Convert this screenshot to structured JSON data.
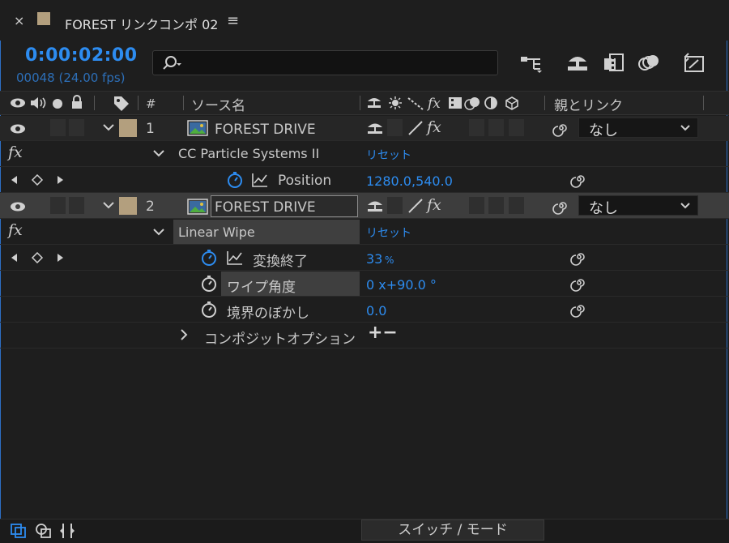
{
  "tab": {
    "close": "×",
    "title": "FOREST リンクコンポ 02",
    "menu": "≡",
    "swatch_color": "#b39f7e"
  },
  "time": {
    "timecode": "0:00:02:00",
    "frames": "00048 (24.00 fps)"
  },
  "search": {
    "value": "",
    "placeholder": ""
  },
  "columns": {
    "hash": "#",
    "source_name": "ソース名",
    "parent_link": "親とリンク"
  },
  "layers": [
    {
      "number": "1",
      "name": "FOREST DRIVE",
      "parent": "なし",
      "selected": false
    },
    {
      "number": "2",
      "name": "FOREST DRIVE",
      "parent": "なし",
      "selected": true
    }
  ],
  "effects": {
    "particle": {
      "fx": "fx",
      "name": "CC Particle Systems II",
      "reset": "リセット",
      "property": {
        "name": "Position",
        "value": "1280.0,540.0"
      }
    },
    "wipe": {
      "fx": "fx",
      "name": "Linear Wipe",
      "reset": "リセット",
      "properties": [
        {
          "name": "変換終了",
          "value": "33",
          "unit": "%"
        },
        {
          "name": "ワイプ角度",
          "value": "0 x+90.0 °"
        },
        {
          "name": "境界のぼかし",
          "value": "0.0"
        }
      ]
    }
  },
  "composite": {
    "label": "コンポジットオプション",
    "plus_minus": "+−"
  },
  "bottom": {
    "switch_label": "スイッチ / モード"
  },
  "colors": {
    "accent": "#2d8cf0",
    "label_tan": "#b39f7e"
  }
}
